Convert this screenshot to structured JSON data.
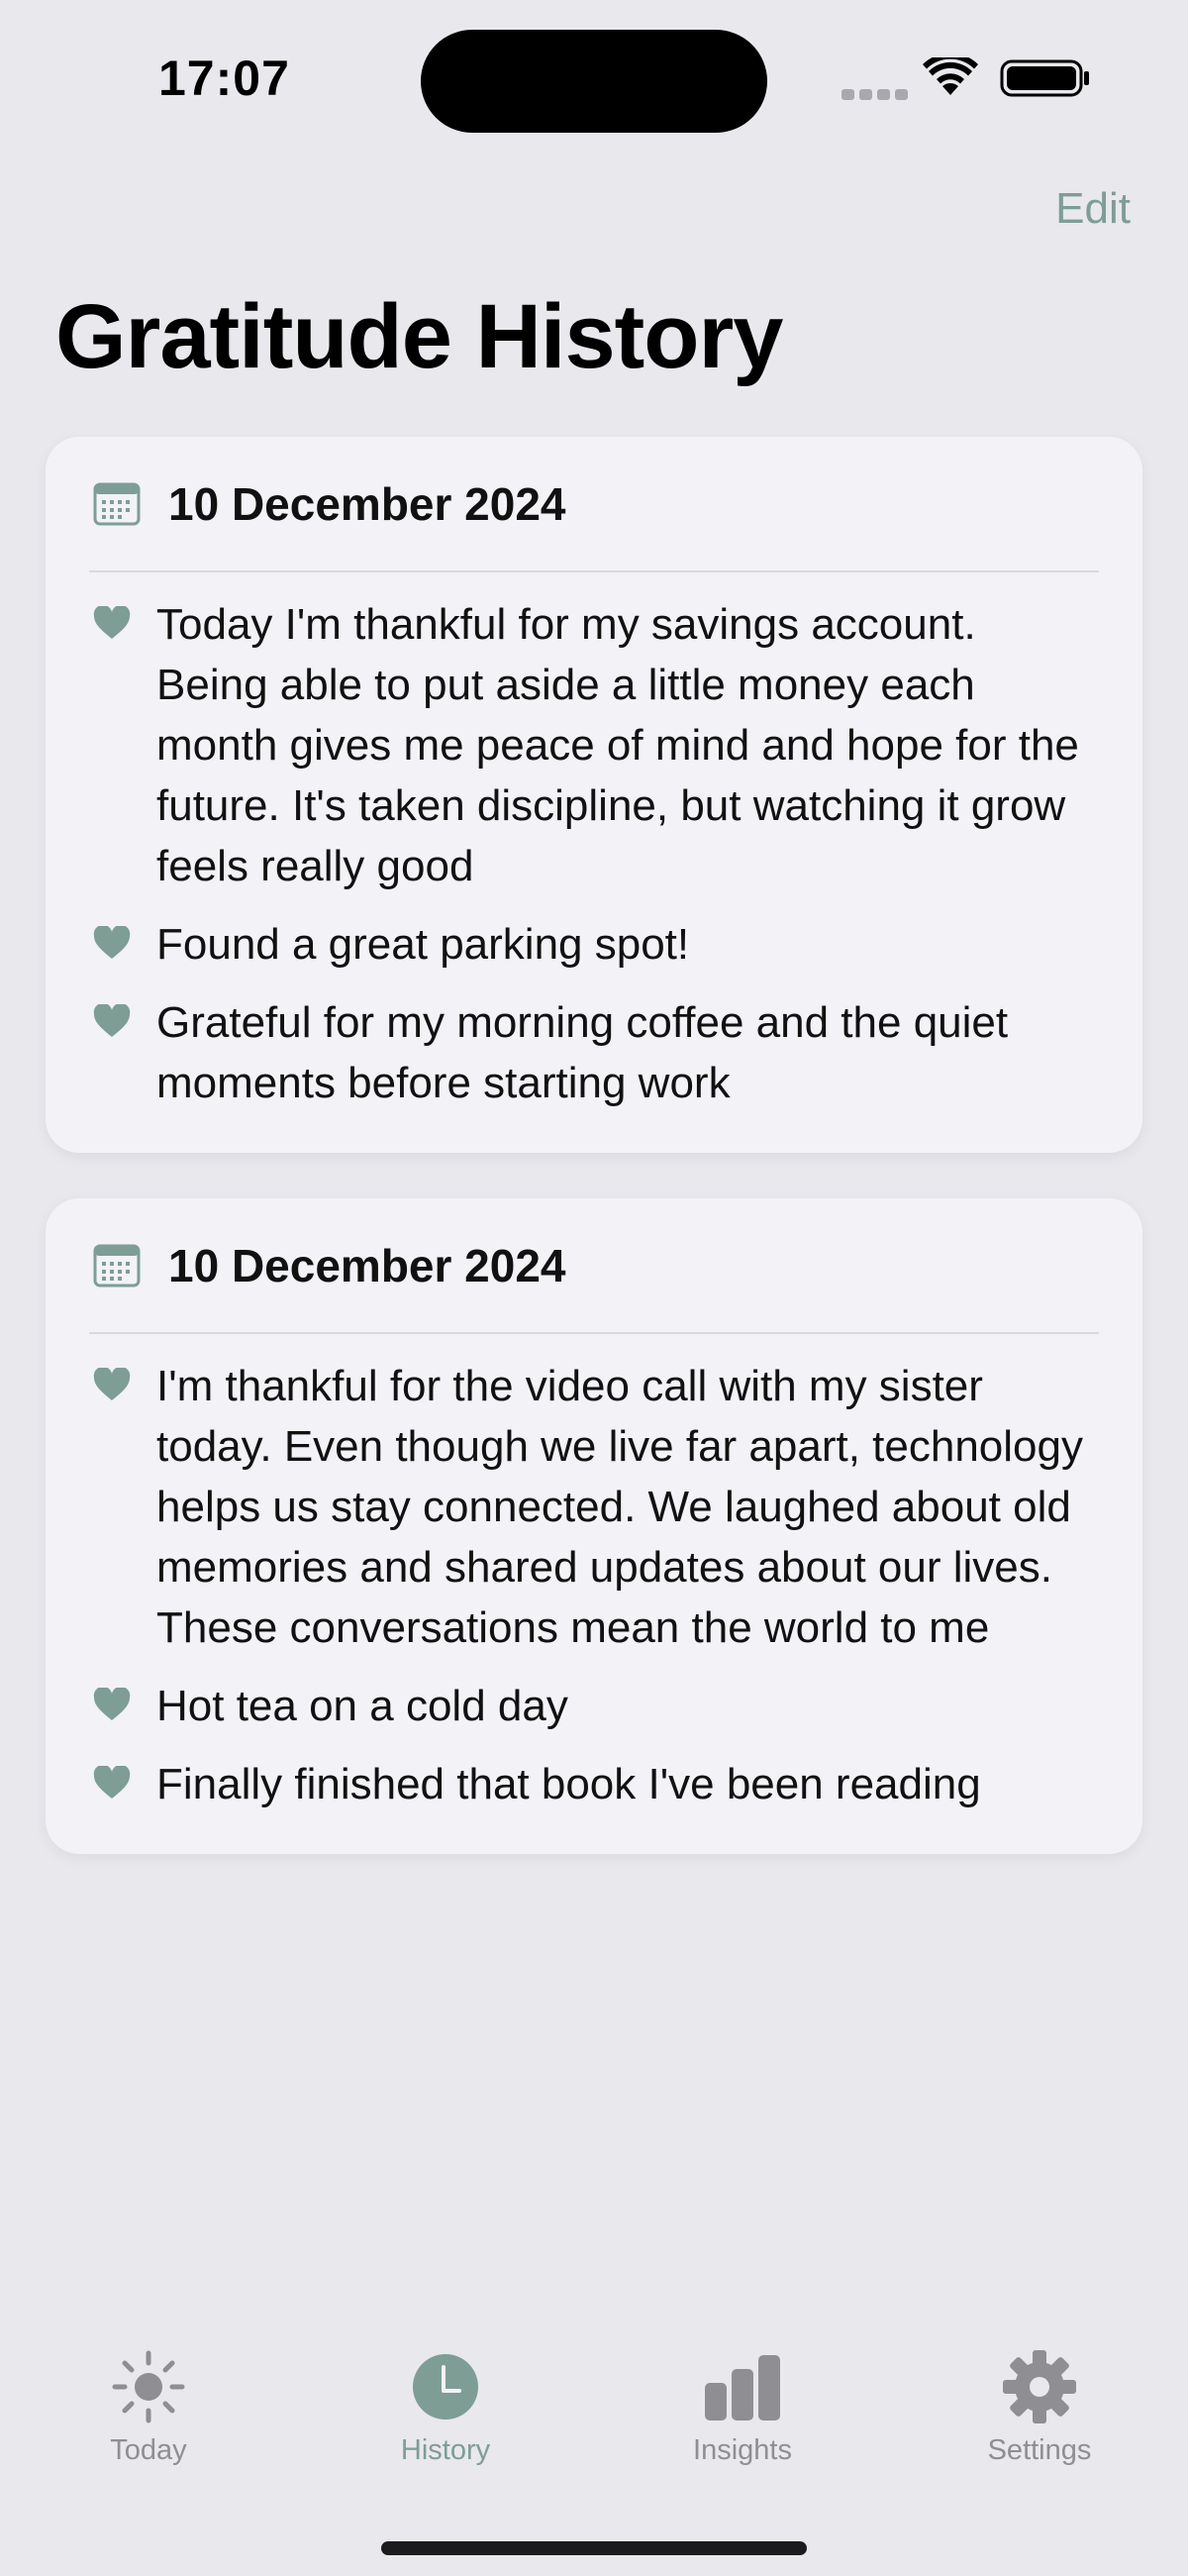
{
  "status_bar": {
    "time": "17:07"
  },
  "nav": {
    "edit_label": "Edit",
    "title": "Gratitude History"
  },
  "colors": {
    "accent": "#7E9D95",
    "background": "#E8E8ED",
    "card": "#F2F2F7",
    "inactive": "#8E8E93"
  },
  "entries": [
    {
      "date": "10 December 2024",
      "items": [
        "Today I'm thankful for my savings account. Being able to put aside a little money each month gives me peace of mind and hope for the future. It's taken discipline, but watching it grow feels really good",
        "Found a great parking spot!",
        "Grateful for my morning coffee and the quiet moments before starting work"
      ]
    },
    {
      "date": "10 December 2024",
      "items": [
        "I'm thankful for the video call with my sister today. Even though we live far apart, technology helps us stay connected. We laughed about old memories and shared updates about our lives. These conversations mean the world to me",
        "Hot tea on a cold day",
        "Finally finished that book I've been reading"
      ]
    }
  ],
  "tabs": [
    {
      "label": "Today",
      "icon": "sun-icon"
    },
    {
      "label": "History",
      "icon": "clock-icon",
      "active": true
    },
    {
      "label": "Insights",
      "icon": "bar-chart-icon"
    },
    {
      "label": "Settings",
      "icon": "gear-icon"
    }
  ]
}
